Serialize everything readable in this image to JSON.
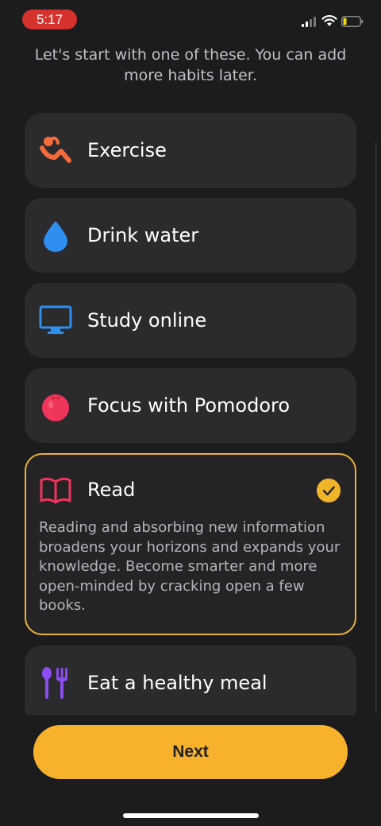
{
  "status_bar": {
    "time": "5:17"
  },
  "intro": {
    "text": "Let's start with one of these. You can add more habits later."
  },
  "habits": [
    {
      "label": "Exercise",
      "icon": "exercise-icon",
      "color": "#f26b3a"
    },
    {
      "label": "Drink water",
      "icon": "water-drop-icon",
      "color": "#2f8ff0"
    },
    {
      "label": "Study online",
      "icon": "monitor-icon",
      "color": "#2f8ff0"
    },
    {
      "label": "Focus with Pomodoro",
      "icon": "tomato-icon",
      "color": "#f0355a"
    },
    {
      "label": "Read",
      "icon": "book-icon",
      "color": "#f0355a",
      "selected": true,
      "description": "Reading and absorbing new information broadens your horizons and expands your knowledge. Become smarter and more open-minded by cracking open a few books."
    },
    {
      "label": "Eat a healthy meal",
      "icon": "utensils-icon",
      "color": "#8b4cf0"
    }
  ],
  "actions": {
    "next_label": "Next"
  },
  "colors": {
    "accent": "#f6b12d",
    "background": "#1c1b1d",
    "card": "#2b2a2d"
  }
}
